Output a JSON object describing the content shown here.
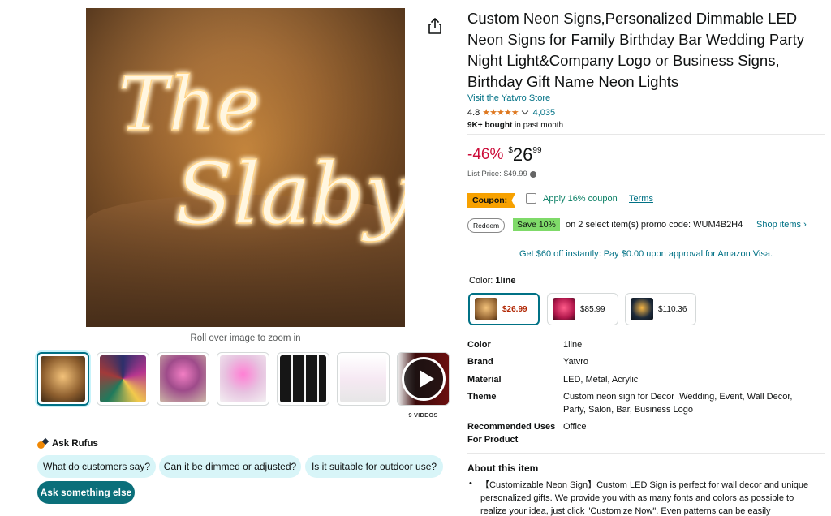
{
  "media": {
    "neon_line1": "The",
    "neon_line2": "Slabys",
    "zoom_hint": "Roll over image to zoom in",
    "video_count_label": "9 VIDEOS"
  },
  "rufus": {
    "title": "Ask Rufus",
    "chips": [
      "What do customers say?",
      "Can it be dimmed or adjusted?",
      "Is it suitable for outdoor use?",
      "Ask something else"
    ]
  },
  "product": {
    "title": "Custom Neon Signs,Personalized Dimmable LED Neon Signs for Family Birthday Bar Wedding Party Night Light&Company Logo or Business Signs, Birthday Gift Name Neon Lights",
    "store_link": "Visit the Yatvro Store",
    "rating": "4.8",
    "stars": "★★★★★",
    "rating_count": "4,035",
    "bought_bold": "9K+ bought",
    "bought_rest": " in past month"
  },
  "price": {
    "discount": "-46%",
    "currency": "$",
    "whole": "26",
    "fraction": "99",
    "list_price_label": "List Price: ",
    "list_price": "$49.99"
  },
  "coupon": {
    "badge": "Coupon:",
    "text": "Apply 16% coupon",
    "terms": "Terms"
  },
  "promo": {
    "redeem": "Redeem",
    "save": "Save 10%",
    "text": "on 2 select item(s) promo code: WUM4B2H4",
    "shop_items": "Shop items ›"
  },
  "visa_offer": "Get $60 off instantly: Pay $0.00 upon approval for Amazon Visa.",
  "color": {
    "label": "Color: ",
    "selected": "1line",
    "options": [
      {
        "price": "$26.99",
        "swatch": "#c98a3c"
      },
      {
        "price": "$85.99",
        "swatch": "#b0174b"
      },
      {
        "price": "$110.36",
        "swatch": "#1d2a3a"
      }
    ]
  },
  "specs": [
    {
      "key": "Color",
      "value": "1line"
    },
    {
      "key": "Brand",
      "value": "Yatvro"
    },
    {
      "key": "Material",
      "value": "LED, Metal, Acrylic"
    },
    {
      "key": "Theme",
      "value": "Custom neon sign for Decor ,Wedding, Event, Wall Decor, Party, Salon, Bar, Business Logo"
    },
    {
      "key": "Recommended Uses For Product",
      "value": "Office"
    }
  ],
  "about": {
    "title": "About this item",
    "bullet_text": "【Customizable Neon Sign】Custom LED Sign is perfect for wall decor and unique personalized gifts. We provide you with as many fonts and colors as possible to realize your idea, just click \"Customize Now\". Even patterns can be easily"
  },
  "colors": {
    "link": "#007185",
    "deal_red": "#cc0c39",
    "coupon_orange": "#f7a100",
    "save_green": "#7fda69",
    "star": "#de7921",
    "rufus_chip": "#d8f5f8",
    "rufus_chip_dark": "#0b6f7a"
  },
  "icons": [
    "share-icon",
    "play-icon",
    "info-icon",
    "rufus-icon",
    "chevron-down-icon"
  ]
}
